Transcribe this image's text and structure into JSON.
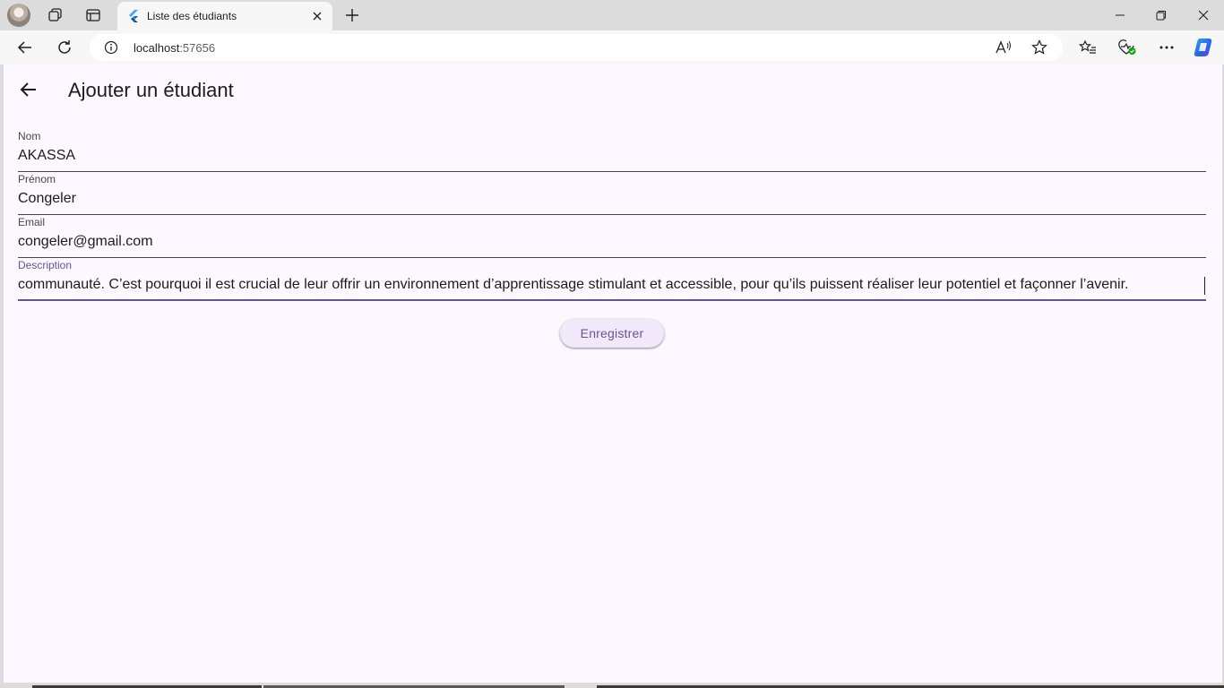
{
  "browser": {
    "tab": {
      "title": "Liste des étudiants"
    },
    "address": {
      "host": "localhost",
      "port": ":57656"
    }
  },
  "app": {
    "title": "Ajouter un étudiant",
    "fields": [
      {
        "label": "Nom",
        "value": "AKASSA"
      },
      {
        "label": "Prénom",
        "value": "Congeler"
      },
      {
        "label": "Email",
        "value": "congeler@gmail.com"
      },
      {
        "label": "Description",
        "value": "communauté. C’est pourquoi il est crucial de leur offrir un environnement d’apprentissage stimulant et accessible, pour qu’ils puissent réaliser leur potentiel et façonner l’avenir."
      }
    ],
    "save_label": "Enregistrer"
  },
  "colors": {
    "accent": "#65558f",
    "surface": "#fdf7ff",
    "button_bg": "#f1e9f9"
  }
}
